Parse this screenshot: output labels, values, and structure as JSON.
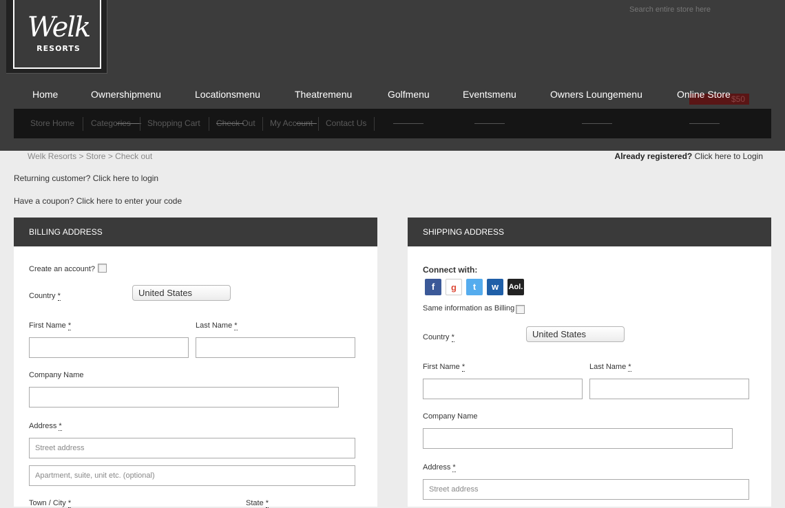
{
  "brand": {
    "script": "Welk",
    "sub": "RESORTS"
  },
  "search": {
    "placeholder": "Search entire store here"
  },
  "nav": {
    "items": [
      "Home",
      "Ownershipmenu",
      "Locationsmenu",
      "Theatremenu",
      "Golfmenu",
      "Eventsmenu",
      "Owners Loungemenu",
      "Online Store"
    ],
    "cart_badge": "$50"
  },
  "subnav": [
    "Store Home",
    "Categories",
    "Shopping Cart",
    "Check Out",
    "My Account",
    "Contact Us"
  ],
  "breadcrumb": "Welk Resorts > Store > Check out",
  "already": {
    "bold": "Already registered?",
    "link": "Click here to Login"
  },
  "returning": "Returning customer? Click here to login",
  "coupon": "Have a coupon? Click here to enter your code",
  "billing": {
    "title": "BILLING ADDRESS",
    "create_account": "Create an account?",
    "country_label": "Country",
    "country_value": "United States",
    "first_name": "First Name",
    "last_name": "Last Name",
    "company": "Company Name",
    "address": "Address",
    "street_placeholder": "Street address",
    "apt_placeholder": "Apartment, suite, unit etc. (optional)",
    "town": "Town / City",
    "state": "State",
    "req": "*"
  },
  "shipping": {
    "title": "SHIPPING ADDRESS",
    "connect": "Connect with:",
    "social": [
      "f",
      "g",
      "t",
      "w",
      "Aol."
    ],
    "same_billing": "Same information as Billing",
    "country_label": "Country",
    "country_value": "United States",
    "first_name": "First Name",
    "last_name": "Last Name",
    "company": "Company Name",
    "address": "Address",
    "street_placeholder": "Street address",
    "req": "*"
  },
  "colors": {
    "header": "#3c3c3c",
    "subnav": "#151515",
    "panel_head": "#3a3a3a",
    "background": "#ececec"
  }
}
